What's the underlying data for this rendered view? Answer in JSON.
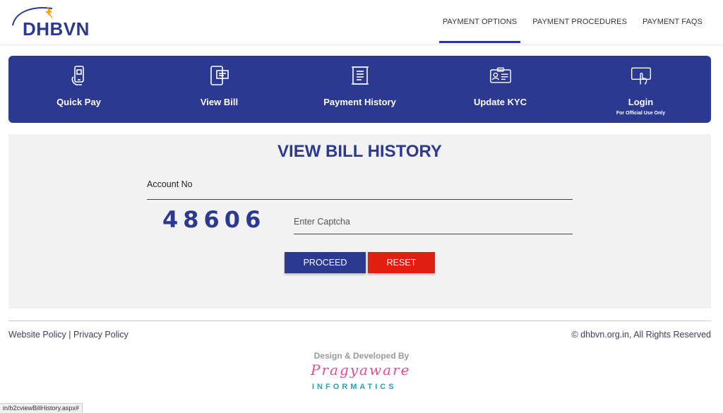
{
  "brand": {
    "logo_text": "DHBVN",
    "primary_color": "#2b3990",
    "accent_red": "#e01f10"
  },
  "nav": [
    {
      "label": "PAYMENT OPTIONS",
      "active": true
    },
    {
      "label": "PAYMENT PROCEDURES",
      "active": false
    },
    {
      "label": "PAYMENT FAQS",
      "active": false
    }
  ],
  "actions": [
    {
      "label": "Quick Pay",
      "icon": "phone-hand-icon"
    },
    {
      "label": "View Bill",
      "icon": "mobile-bill-icon"
    },
    {
      "label": "Payment History",
      "icon": "scroll-list-icon"
    },
    {
      "label": "Update KYC",
      "icon": "id-card-icon"
    },
    {
      "label": "Login",
      "sub": "For Official Use Only",
      "icon": "touch-screen-icon"
    }
  ],
  "form": {
    "title": "VIEW BILL HISTORY",
    "account_label": "Account No",
    "captcha_value": "48606",
    "captcha_placeholder": "Enter Captcha",
    "proceed_label": "PROCEED",
    "reset_label": "RESET"
  },
  "footer": {
    "website_policy": "Website Policy",
    "separator": " | ",
    "privacy_policy": "Privacy Policy",
    "copyright": "© dhbvn.org.in, All Rights Reserved",
    "credit": "Design & Developed By",
    "dev_name": "Pragyaware",
    "dev_sub": "INFORMATICS"
  },
  "status_url": "in/b2cviewBillHistory.aspx#"
}
